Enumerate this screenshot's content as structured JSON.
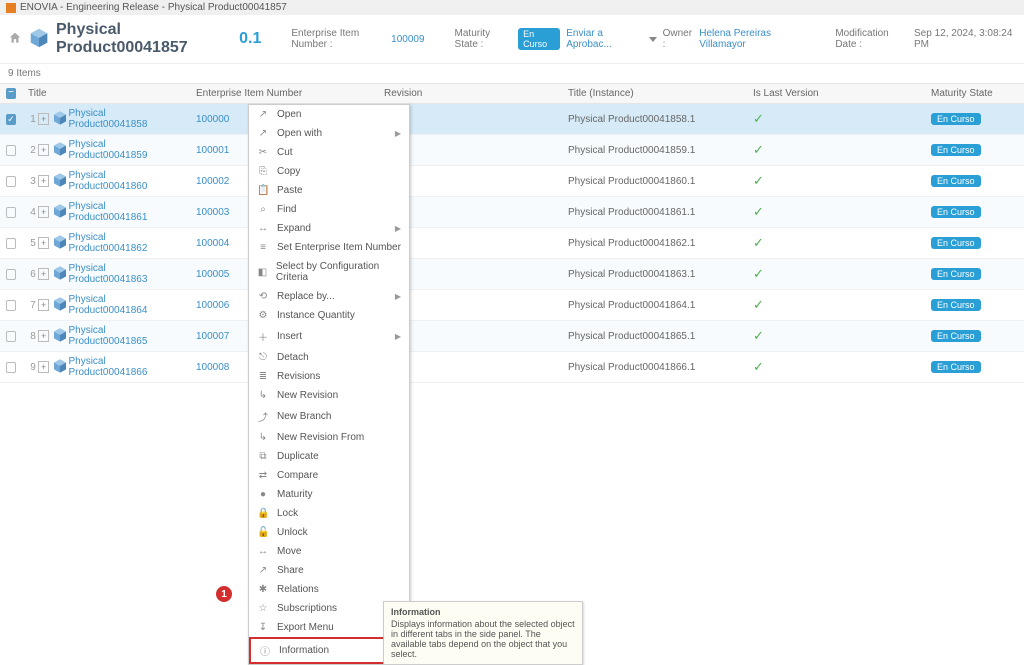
{
  "window_title": "ENOVIA - Engineering Release - Physical Product00041857",
  "header": {
    "product_name": "Physical Product00041857",
    "revision": "0.1",
    "ein_label": "Enterprise Item Number :",
    "ein_value": "100009",
    "maturity_label": "Maturity State :",
    "maturity_badge": "En Curso",
    "send_action": "Enviar a Aprobac...",
    "owner_label": "Owner :",
    "owner_value": "Helena Pereiras Villamayor",
    "mod_label": "Modification Date :",
    "mod_value": "Sep 12, 2024, 3:08:24 PM"
  },
  "items_count": "9 Items",
  "columns": {
    "title": "Title",
    "ein": "Enterprise Item Number",
    "revision": "Revision",
    "title_instance": "Title (Instance)",
    "is_last": "Is Last Version",
    "maturity": "Maturity State"
  },
  "rows": [
    {
      "n": "1",
      "title": "Physical Product00041858",
      "ein": "100000",
      "ti": "Physical Product00041858.1",
      "ms": "En Curso",
      "sel": true
    },
    {
      "n": "2",
      "title": "Physical Product00041859",
      "ein": "100001",
      "ti": "Physical Product00041859.1",
      "ms": "En Curso",
      "sel": false
    },
    {
      "n": "3",
      "title": "Physical Product00041860",
      "ein": "100002",
      "ti": "Physical Product00041860.1",
      "ms": "En Curso",
      "sel": false
    },
    {
      "n": "4",
      "title": "Physical Product00041861",
      "ein": "100003",
      "ti": "Physical Product00041861.1",
      "ms": "En Curso",
      "sel": false
    },
    {
      "n": "5",
      "title": "Physical Product00041862",
      "ein": "100004",
      "ti": "Physical Product00041862.1",
      "ms": "En Curso",
      "sel": false
    },
    {
      "n": "6",
      "title": "Physical Product00041863",
      "ein": "100005",
      "ti": "Physical Product00041863.1",
      "ms": "En Curso",
      "sel": false
    },
    {
      "n": "7",
      "title": "Physical Product00041864",
      "ein": "100006",
      "ti": "Physical Product00041864.1",
      "ms": "En Curso",
      "sel": false
    },
    {
      "n": "8",
      "title": "Physical Product00041865",
      "ein": "100007",
      "ti": "Physical Product00041865.1",
      "ms": "En Curso",
      "sel": false
    },
    {
      "n": "9",
      "title": "Physical Product00041866",
      "ein": "100008",
      "ti": "Physical Product00041866.1",
      "ms": "En Curso",
      "sel": false
    }
  ],
  "context_menu": [
    {
      "label": "Open",
      "icon": "↗",
      "sub": false
    },
    {
      "label": "Open with",
      "icon": "↗",
      "sub": true
    },
    {
      "label": "Cut",
      "icon": "✂",
      "sub": false
    },
    {
      "label": "Copy",
      "icon": "⎘",
      "sub": false
    },
    {
      "label": "Paste",
      "icon": "📋",
      "sub": false
    },
    {
      "label": "Find",
      "icon": "⌕",
      "sub": false
    },
    {
      "label": "Expand",
      "icon": "↔",
      "sub": true
    },
    {
      "label": "Set Enterprise Item Number",
      "icon": "≡",
      "sub": false
    },
    {
      "label": "Select by Configuration Criteria",
      "icon": "◧",
      "sub": false
    },
    {
      "label": "Replace by...",
      "icon": "⟲",
      "sub": true
    },
    {
      "label": "Instance Quantity",
      "icon": "⚙",
      "sub": false
    },
    {
      "label": "Insert",
      "icon": "＋",
      "sub": true
    },
    {
      "label": "Detach",
      "icon": "⎋",
      "sub": false
    },
    {
      "label": "Revisions",
      "icon": "≣",
      "sub": false
    },
    {
      "label": "New Revision",
      "icon": "↳",
      "sub": false
    },
    {
      "label": "New Branch",
      "icon": "⤴",
      "sub": false
    },
    {
      "label": "New Revision From",
      "icon": "↳",
      "sub": false
    },
    {
      "label": "Duplicate",
      "icon": "⧉",
      "sub": false
    },
    {
      "label": "Compare",
      "icon": "⇄",
      "sub": false
    },
    {
      "label": "Maturity",
      "icon": "●",
      "sub": false
    },
    {
      "label": "Lock",
      "icon": "🔒",
      "sub": false
    },
    {
      "label": "Unlock",
      "icon": "🔓",
      "sub": false
    },
    {
      "label": "Move",
      "icon": "↔",
      "sub": false
    },
    {
      "label": "Share",
      "icon": "↗",
      "sub": false
    },
    {
      "label": "Relations",
      "icon": "✱",
      "sub": false
    },
    {
      "label": "Subscriptions",
      "icon": "☆",
      "sub": true
    },
    {
      "label": "Export Menu",
      "icon": "↧",
      "sub": true
    },
    {
      "label": "Information",
      "icon": "ⓘ",
      "sub": false,
      "highlight": true
    }
  ],
  "tooltip": {
    "title": "Information",
    "body": "Displays information about the selected object in different tabs in the side panel. The available tabs depend on the object that you select."
  },
  "marker": "1"
}
